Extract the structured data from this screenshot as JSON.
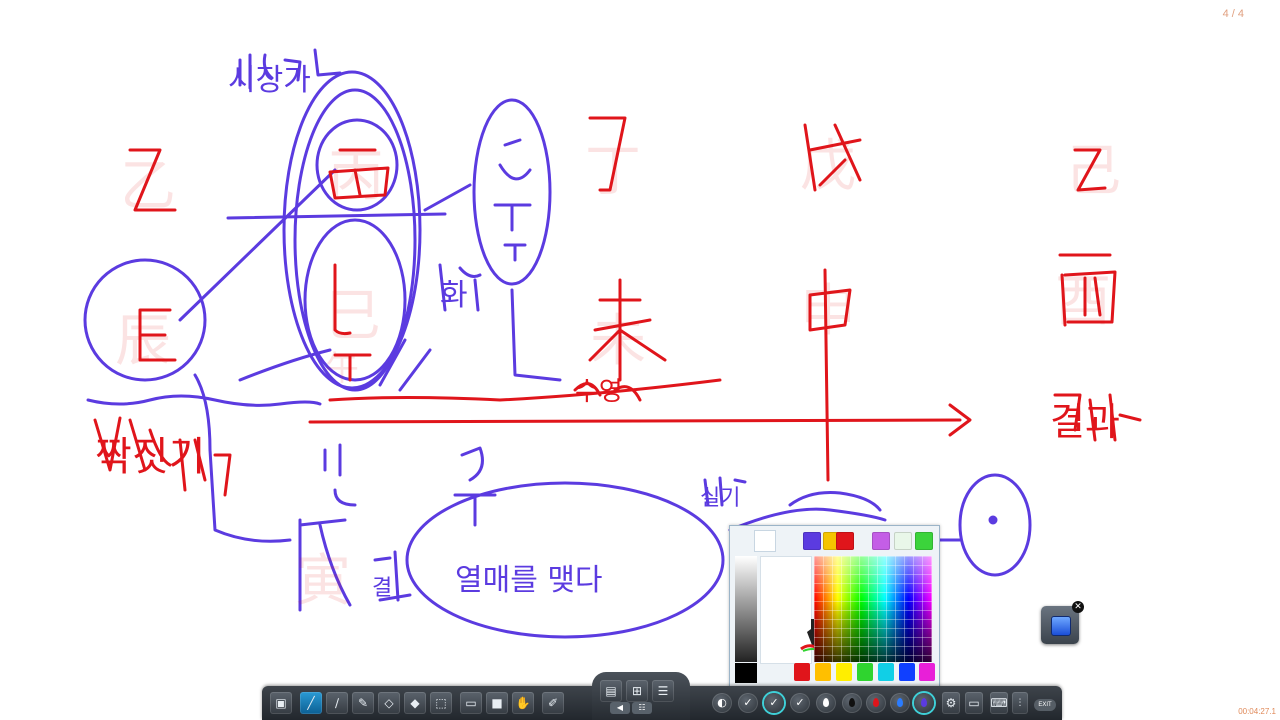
{
  "page_indicator": "4 / 4",
  "timer": "00:04:27.1",
  "colors": {
    "red_ink": "#e0151b",
    "purple_ink": "#5b3be0",
    "accent": "#2a9ad4"
  },
  "drawing_text": {
    "top_label": "시장가",
    "hwa": "화",
    "suseong": "수영",
    "jjakjitgi": "짝짓기",
    "gyeolgwa": "결과",
    "sil": "실기",
    "gyeol": "결",
    "yeolmae": "열매를 맺다",
    "ji_1": "乙",
    "ji_2": "丁",
    "ji_3": "戊",
    "ji_4": "己",
    "ji_5": "未",
    "ji_6": "申",
    "ji_7": "酉",
    "ji_8": "辰",
    "ji_9": "丙",
    "ji_10": "巳",
    "ji_11": "午",
    "ji_12": "寅"
  },
  "color_picker": {
    "presets": [
      "#ffffff",
      "#5b3be0",
      "#f5c400",
      "#e0151b",
      "#c45ee6",
      "#e9f7e9",
      "#3bd33b"
    ],
    "bottom_swatches": [
      "#e0151b",
      "#ffbf00",
      "#ffee00",
      "#2fd42f",
      "#11cfe6",
      "#1040ff",
      "#e81fd8"
    ]
  },
  "toolbar": {
    "tools": [
      "board-icon",
      "pen-icon",
      "highlighter-icon",
      "brush-icon",
      "shape-eraser-icon",
      "eraser-icon",
      "select-icon",
      "screen-icon",
      "color-icon",
      "hand-icon",
      "paint-icon"
    ],
    "exit_label": "EXIT"
  }
}
